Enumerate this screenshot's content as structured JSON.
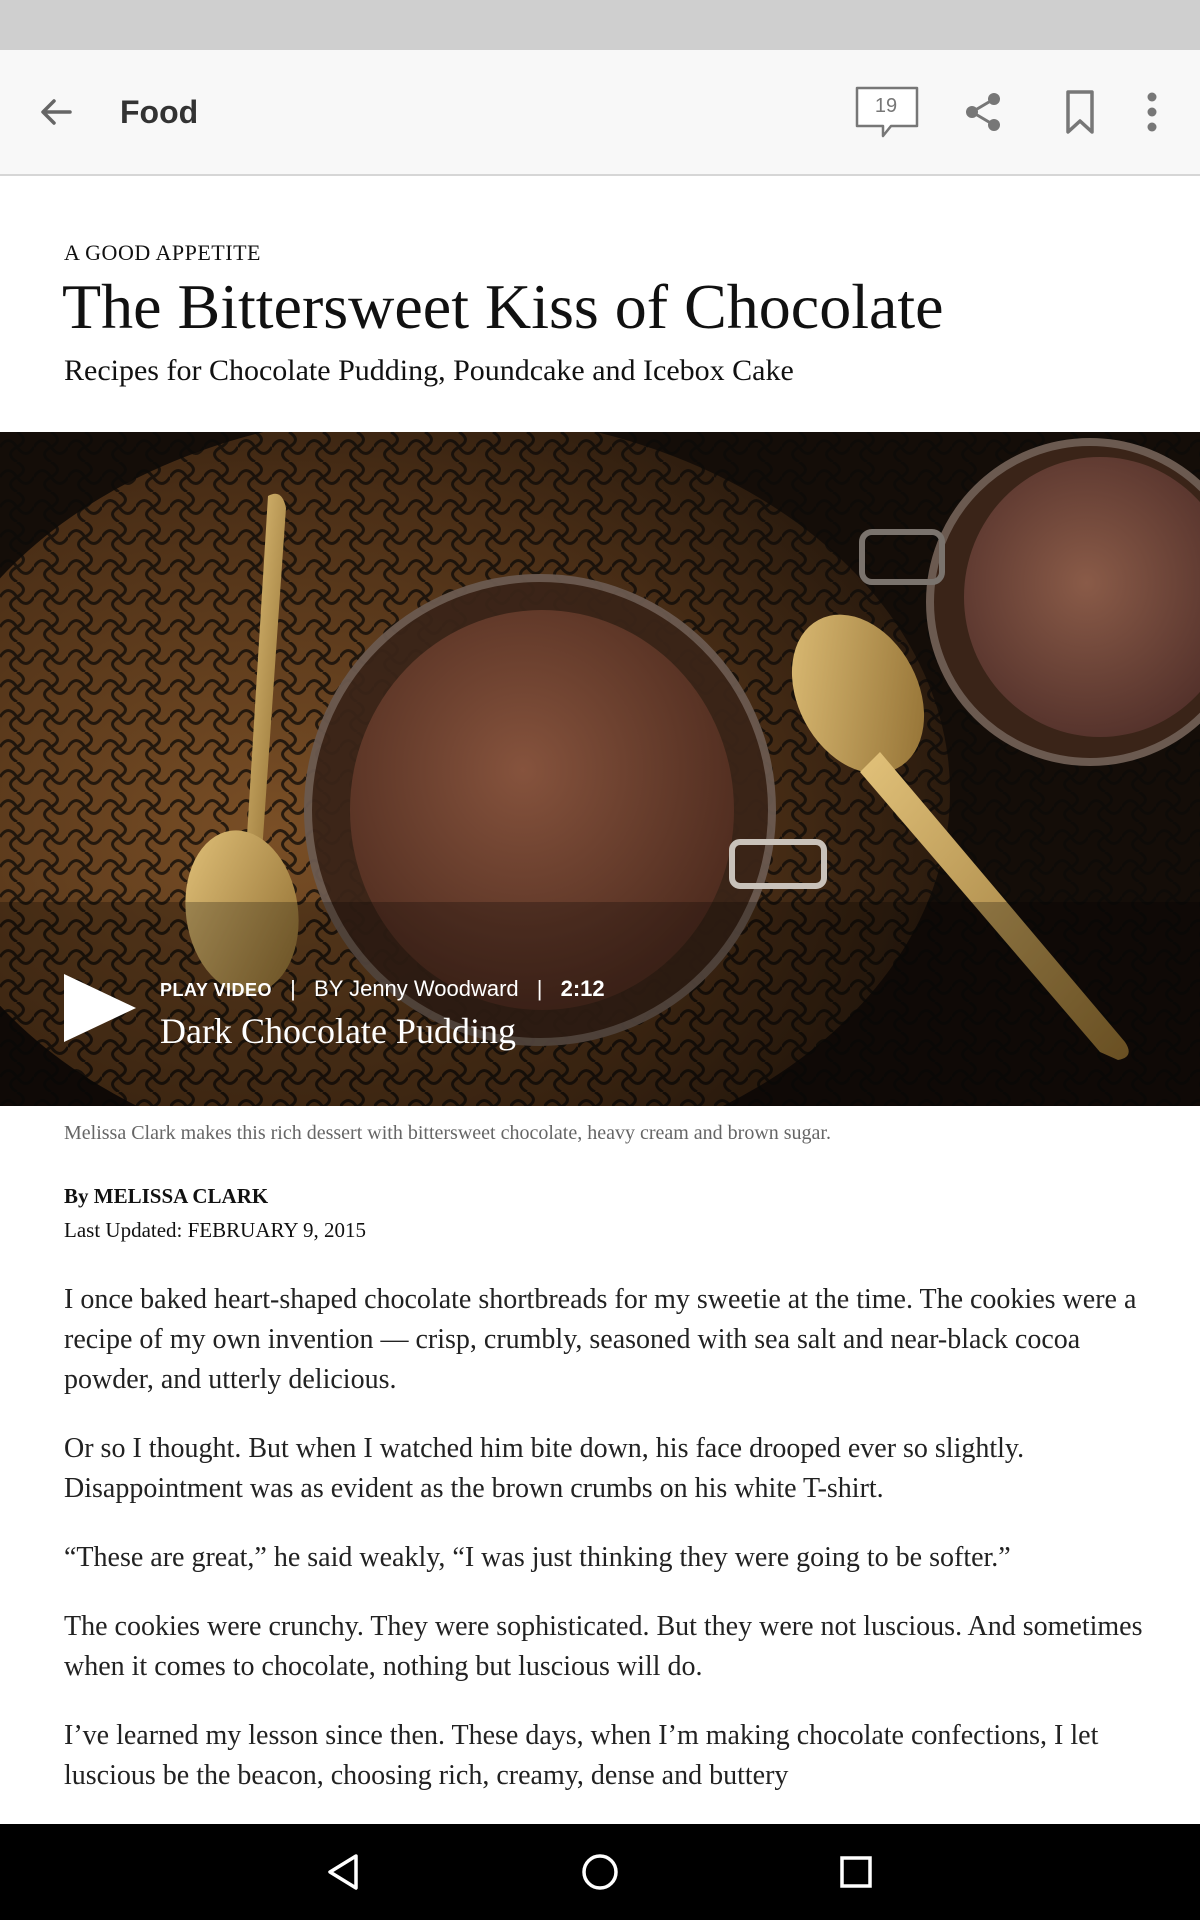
{
  "app_bar": {
    "section_title": "Food",
    "comment_count": "19",
    "icons": {
      "back": "arrow-left-icon",
      "comments": "comment-bubble-icon",
      "share": "share-icon",
      "bookmark": "bookmark-icon",
      "more": "more-vertical-icon"
    }
  },
  "article": {
    "kicker": "A GOOD APPETITE",
    "headline": "The Bittersweet Kiss of Chocolate",
    "deck": "Recipes for Chocolate Pudding, Poundcake and Icebox Cake",
    "video": {
      "label": "PLAY VIDEO",
      "byline": "BY Jenny Woodward",
      "duration": "2:12",
      "title": "Dark Chocolate Pudding"
    },
    "caption": "Melissa Clark makes this rich dessert with bittersweet chocolate, heavy cream and brown sugar.",
    "byline": "By MELISSA CLARK",
    "updated": "Last Updated: FEBRUARY 9, 2015",
    "paragraphs": [
      "I once baked heart-shaped chocolate shortbreads for my sweetie at the time. The cookies were a recipe of my own invention — crisp, crumbly, seasoned with sea salt and near-black cocoa powder, and utterly delicious.",
      "Or so I thought. But when I watched him bite down, his face drooped ever so slightly. Disappointment was as evident as the brown crumbs on his white T-shirt.",
      "“These are great,” he said weakly, “I was just thinking they were going to be softer.”",
      "The cookies were crunchy. They were sophisticated. But they were not luscious. And sometimes when it comes to chocolate, nothing but luscious will do.",
      "I’ve learned my lesson since then. These days, when I’m making chocolate confections, I let luscious be the beacon, choosing rich, creamy, dense and buttery"
    ]
  },
  "nav_bar": {
    "icons": {
      "back": "triangle-back-icon",
      "home": "circle-home-icon",
      "recents": "square-recents-icon"
    }
  },
  "colors": {
    "status_bar": "#cfcfcf",
    "app_bar": "#f8f8f8",
    "nav_bar": "#000000",
    "text": "#111111",
    "caption": "#666666"
  }
}
